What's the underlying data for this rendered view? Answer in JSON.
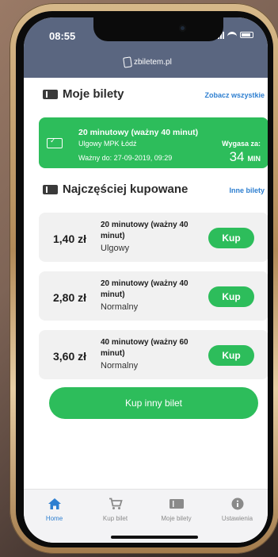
{
  "status": {
    "time": "08:55"
  },
  "app": {
    "logo_text": "zbiletem.pl"
  },
  "my_tickets": {
    "title": "Moje bilety",
    "link": "Zobacz wszystkie",
    "active_ticket": {
      "name": "20 minutowy (ważny 40 minut)",
      "tariff": "Ulgowy MPK Łódź",
      "valid_until": "Ważny do: 27-09-2019, 09:29",
      "expires_label": "Wygasa za:",
      "expires_value": "34",
      "expires_unit": "MIN"
    }
  },
  "popular": {
    "title": "Najczęściej kupowane",
    "link": "Inne bilety",
    "offers": [
      {
        "price": "1,40 zł",
        "name": "20 minutowy (ważny 40 minut)",
        "type": "Ulgowy",
        "button": "Kup"
      },
      {
        "price": "2,80 zł",
        "name": "20 minutowy (ważny 40 minut)",
        "type": "Normalny",
        "button": "Kup"
      },
      {
        "price": "3,60 zł",
        "name": "40 minutowy (ważny 60 minut)",
        "type": "Normalny",
        "button": "Kup"
      }
    ]
  },
  "buy_other": "Kup inny bilet",
  "tabs": [
    {
      "label": "Home",
      "icon": "home-icon",
      "active": true
    },
    {
      "label": "Kup bilet",
      "icon": "cart-icon",
      "active": false
    },
    {
      "label": "Moje bilety",
      "icon": "ticket-icon",
      "active": false
    },
    {
      "label": "Ustawienia",
      "icon": "info-icon",
      "active": false
    }
  ],
  "colors": {
    "accent_green": "#2dbd5b",
    "header": "#5a6680",
    "link_blue": "#2e7fd0",
    "tab_active": "#2e7fd0",
    "tab_inactive": "#8a8a8a"
  }
}
